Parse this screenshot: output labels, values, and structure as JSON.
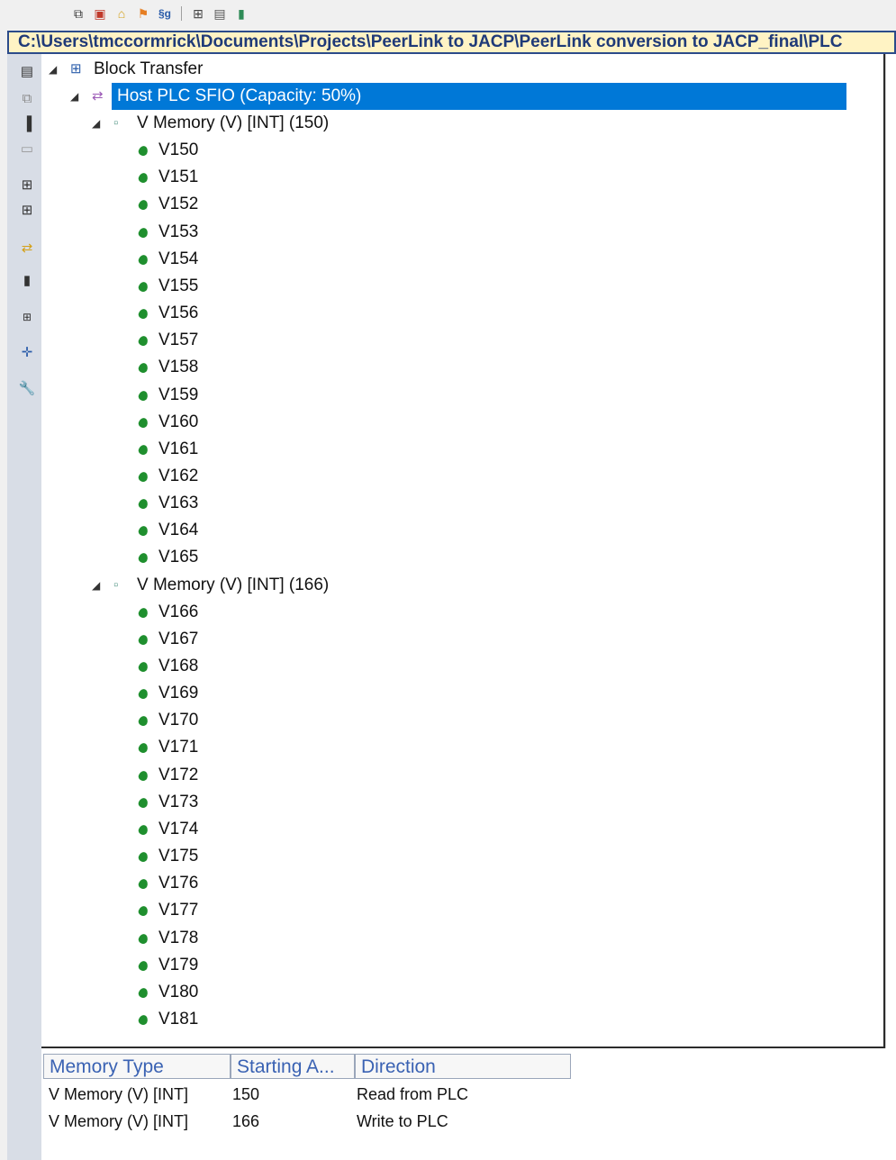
{
  "toolbar": {
    "icons": [
      "network-icon",
      "io-config-icon",
      "home-icon",
      "flag-icon",
      "sg-icon",
      "grid-icon",
      "export-icon",
      "chart-icon"
    ]
  },
  "path": "C:\\Users\\tmccormrick\\Documents\\Projects\\PeerLink to JACP\\PeerLink conversion to JACP_final\\PLC",
  "sidebar_icons": [
    "tree-view-icon",
    "network-icon",
    "device-icon",
    "printer-icon",
    "table-icon",
    "table-alt-icon",
    "transfer-icon",
    "import-icon",
    "expand-icon",
    "axis-icon",
    "wrench-icon"
  ],
  "tree": {
    "root": "Block Transfer",
    "host": "Host PLC SFIO (Capacity: 50%)",
    "groups": [
      {
        "label": "V Memory (V) [INT] (150)",
        "items": [
          "V150",
          "V151",
          "V152",
          "V153",
          "V154",
          "V155",
          "V156",
          "V157",
          "V158",
          "V159",
          "V160",
          "V161",
          "V162",
          "V163",
          "V164",
          "V165"
        ]
      },
      {
        "label": "V Memory (V) [INT] (166)",
        "items": [
          "V166",
          "V167",
          "V168",
          "V169",
          "V170",
          "V171",
          "V172",
          "V173",
          "V174",
          "V175",
          "V176",
          "V177",
          "V178",
          "V179",
          "V180",
          "V181"
        ]
      }
    ]
  },
  "grid": {
    "headers": [
      "Memory Type",
      "Starting A...",
      "Direction"
    ],
    "rows": [
      {
        "type": "V Memory (V) [INT]",
        "start": "150",
        "direction": "Read from PLC"
      },
      {
        "type": "V Memory (V) [INT]",
        "start": "166",
        "direction": "Write to PLC"
      }
    ]
  }
}
